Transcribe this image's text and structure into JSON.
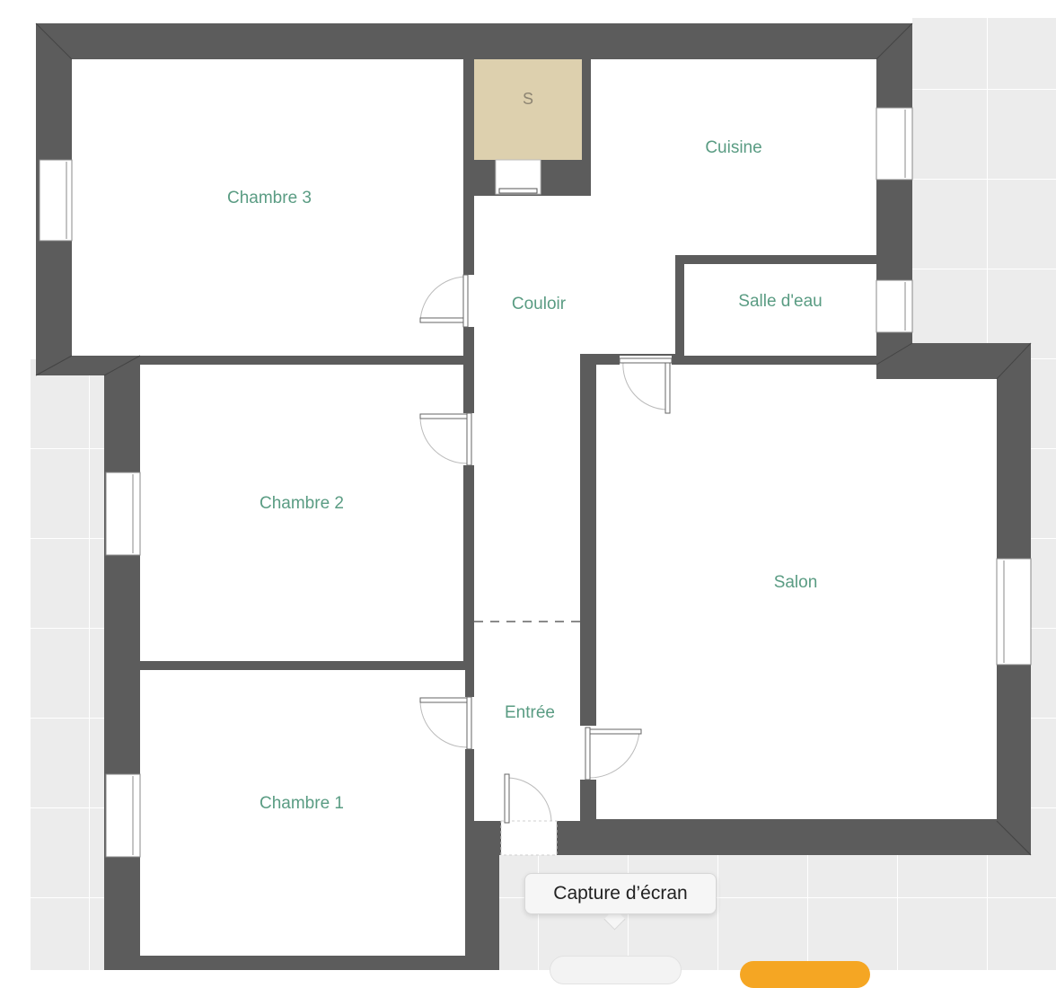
{
  "rooms": {
    "chambre3": "Chambre 3",
    "chambre2": "Chambre 2",
    "chambre1": "Chambre 1",
    "storage": "S",
    "cuisine": "Cuisine",
    "couloir": "Couloir",
    "salle_eau": "Salle d'eau",
    "salon": "Salon",
    "entree": "Entrée"
  },
  "tooltip": {
    "label": "Capture d’écran"
  },
  "colors": {
    "wall": "#5c5c5c",
    "floor": "#ffffff",
    "storage_fill": "#ddd0ae",
    "label": "#5a9c83",
    "background_tile": "#ececec",
    "button_accent": "#f5a623"
  },
  "icons": {
    "door": "door-swing-icon",
    "window": "window-icon"
  }
}
